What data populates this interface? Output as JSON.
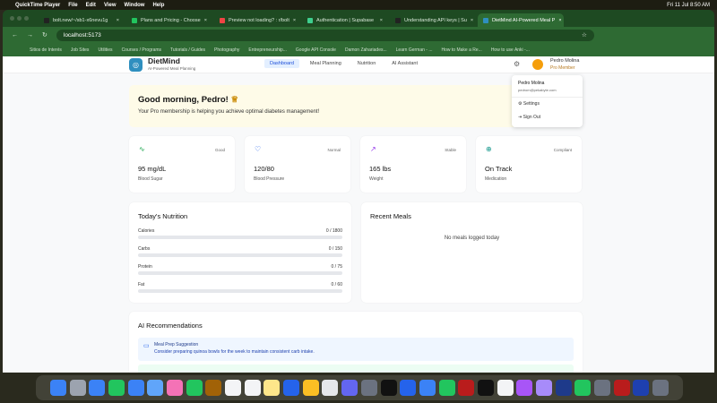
{
  "menubar": {
    "app": "QuickTime Player",
    "items": [
      "File",
      "Edit",
      "View",
      "Window",
      "Help"
    ],
    "clock": "Fri 11 Jul  8:50 AM"
  },
  "browser": {
    "tabs": [
      {
        "label": "bolt.new/~/sb1-x6nevu1g",
        "color": "#222"
      },
      {
        "label": "Plans and Pricing - Choose",
        "color": "#22c55e"
      },
      {
        "label": "Preview not loading? : r/bolt",
        "color": "#ef4444"
      },
      {
        "label": "Authentication | Supabase",
        "color": "#3ecf8e"
      },
      {
        "label": "Understanding API keys | Su",
        "color": "#222"
      },
      {
        "label": "DietMind AI-Powered Meal P",
        "color": "#2f8fbf"
      }
    ],
    "url": "localhost:5173",
    "bookmarks": [
      "Sitios de Interés",
      "Job Sites",
      "Utilities",
      "Courses / Programs",
      "Tutorials / Guides",
      "Photography",
      "Entrepreneurship...",
      "Google API Console",
      "Damon Zahariades...",
      "Learn German - ...",
      "How to Make a Re...",
      "How to use Anki -..."
    ]
  },
  "app": {
    "brand": "DietMind",
    "tagline": "AI-Powered Meal Planning",
    "nav": [
      "Dashboard",
      "Meal Planning",
      "Nutrition",
      "AI Assistant"
    ],
    "user": {
      "name": "Pedro Molina",
      "membership": "Pro Member",
      "email": "pedrom@pekabyte.com"
    },
    "dropdown": {
      "settings": "Settings",
      "signout": "Sign Out"
    },
    "greeting": {
      "title": "Good morning, Pedro!",
      "crown": "♕",
      "message": "Your Pro membership is helping you achieve optimal diabetes management!"
    },
    "stats": [
      {
        "icon": "∿",
        "color": "#16a34a",
        "status": "Good",
        "value": "95 mg/dL",
        "label": "Blood Sugar"
      },
      {
        "icon": "♡",
        "color": "#2563eb",
        "status": "Normal",
        "value": "120/80",
        "label": "Blood Pressure"
      },
      {
        "icon": "↗",
        "color": "#9333ea",
        "status": "Stable",
        "value": "165 lbs",
        "label": "Weight"
      },
      {
        "icon": "⊕",
        "color": "#0d9488",
        "status": "Compliant",
        "value": "On Track",
        "label": "Medication"
      }
    ],
    "nutrition": {
      "title": "Today's Nutrition",
      "rows": [
        {
          "label": "Calories",
          "value": "0 / 1800",
          "progress": 0
        },
        {
          "label": "Carbs",
          "value": "0 / 150",
          "progress": 0
        },
        {
          "label": "Protein",
          "value": "0 / 75",
          "progress": 0
        },
        {
          "label": "Fat",
          "value": "0 / 60",
          "progress": 0
        }
      ]
    },
    "meals": {
      "title": "Recent Meals",
      "empty": "No meals logged today"
    },
    "ai": {
      "title": "AI Recommendations",
      "items": [
        {
          "title": "Meal Prep Suggestion",
          "desc": "Consider preparing quinoa bowls for the week to maintain consistent carb intake."
        }
      ]
    }
  },
  "dock": [
    "Finder",
    "Launchpad",
    "Safari",
    "Messages",
    "Mail",
    "Maps",
    "Photos",
    "FaceTime",
    "Notes App",
    "Calendar",
    "Reminders",
    "Notes",
    "App Store",
    "Chrome",
    "Slack",
    "Discord",
    "Settings",
    "Terminal",
    "VS Code",
    "Docker",
    "Numbers",
    "FileZilla",
    "Spotify",
    "Notion",
    "Podcasts",
    "Affinity",
    "WordPress",
    "WhatsApp",
    "Calculator",
    "Acrobat",
    "QuickTime",
    "Trash"
  ],
  "dock_colors": [
    "#3b82f6",
    "#9ca3af",
    "#3b82f6",
    "#22c55e",
    "#3b82f6",
    "#60a5fa",
    "#f472b6",
    "#22c55e",
    "#a16207",
    "#f3f4f6",
    "#f3f4f6",
    "#fde68a",
    "#2563eb",
    "#fbbf24",
    "#e5e7eb",
    "#6366f1",
    "#6b7280",
    "#111",
    "#2563eb",
    "#3b82f6",
    "#22c55e",
    "#b91c1c",
    "#111",
    "#f3f4f6",
    "#a855f7",
    "#a78bfa",
    "#1e3a8a",
    "#22c55e",
    "#6b7280",
    "#b91c1c",
    "#1e40af",
    "#6b7280"
  ]
}
